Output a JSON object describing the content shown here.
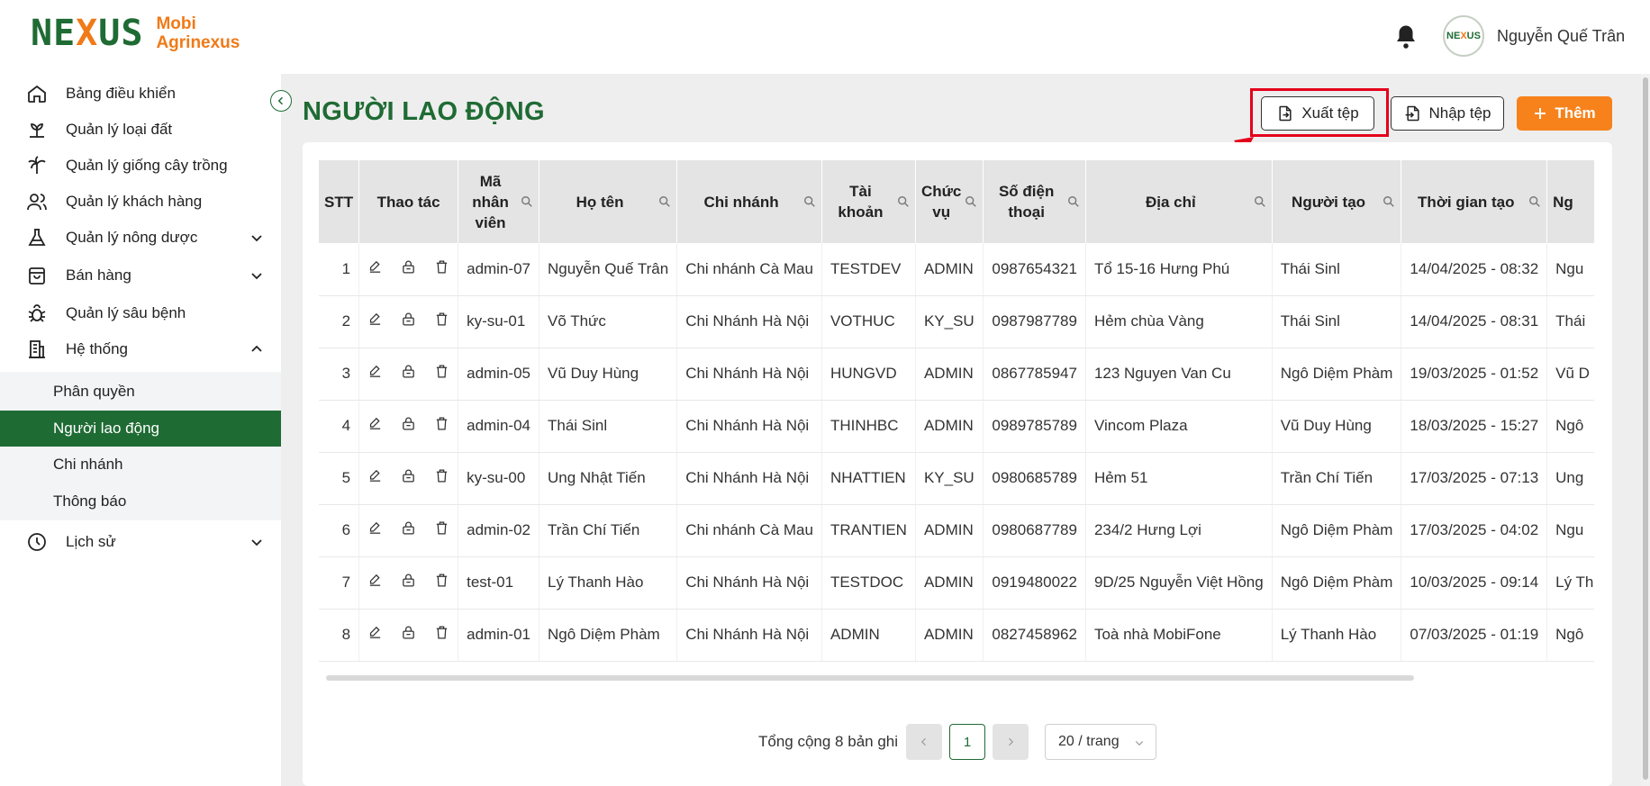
{
  "app": {
    "brand_mark_left": "NE",
    "brand_mark_x": "X",
    "brand_mark_right": "US",
    "brand_line1": "Mobi",
    "brand_line2": "Agrinexus",
    "avatar_text_left": "NE",
    "avatar_text_x": "X",
    "avatar_text_right": "US",
    "user_name": "Nguyễn Quế Trân"
  },
  "sidebar": {
    "items": [
      {
        "label": "Bảng điều khiển",
        "icon": "home-icon"
      },
      {
        "label": "Quản lý loại đất",
        "icon": "sprout-icon"
      },
      {
        "label": "Quản lý giống cây trồng",
        "icon": "palm-icon"
      },
      {
        "label": "Quản lý khách hàng",
        "icon": "users-icon"
      },
      {
        "label": "Quản lý nông dược",
        "icon": "flask-icon"
      },
      {
        "label": "Bán hàng",
        "icon": "bag-icon"
      },
      {
        "label": "Quản lý sâu bệnh",
        "icon": "bug-icon"
      },
      {
        "label": "Hệ thống",
        "icon": "building-icon"
      },
      {
        "label": "Lịch sử",
        "icon": "clock-icon"
      }
    ],
    "submenu": [
      {
        "label": "Phân quyền"
      },
      {
        "label": "Người lao động",
        "active": true
      },
      {
        "label": "Chi nhánh"
      },
      {
        "label": "Thông báo"
      }
    ]
  },
  "page": {
    "title": "NGƯỜI LAO ĐỘNG",
    "export_label": "Xuất tệp",
    "import_label": "Nhập tệp",
    "add_label": "Thêm"
  },
  "table": {
    "headers": [
      "STT",
      "Thao tác",
      "Mã nhân viên",
      "Họ tên",
      "Chi nhánh",
      "Tài khoản",
      "Chức vụ",
      "Số điện thoại",
      "Địa chỉ",
      "Người tạo",
      "Thời gian tạo",
      "Ng"
    ],
    "rows": [
      [
        "1",
        "admin-07",
        "Nguyễn Quế Trân",
        "Chi nhánh Cà Mau",
        "TESTDEV",
        "ADMIN",
        "0987654321",
        "Tổ 15-16 Hưng Phú",
        "Thái Sinl",
        "14/04/2025 - 08:32",
        "Ngu"
      ],
      [
        "2",
        "ky-su-01",
        "Võ Thức",
        "Chi Nhánh Hà Nội",
        "VOTHUC",
        "KY_SU",
        "0987987789",
        "Hẻm chùa Vàng",
        "Thái Sinl",
        "14/04/2025 - 08:31",
        "Thái"
      ],
      [
        "3",
        "admin-05",
        "Vũ Duy Hùng",
        "Chi Nhánh Hà Nội",
        "HUNGVD",
        "ADMIN",
        "0867785947",
        "123 Nguyen Van Cu",
        "Ngô Diệm Phàm",
        "19/03/2025 - 01:52",
        "Vũ D"
      ],
      [
        "4",
        "admin-04",
        "Thái Sinl",
        "Chi Nhánh Hà Nội",
        "THINHBC",
        "ADMIN",
        "0989785789",
        "Vincom Plaza",
        "Vũ Duy Hùng",
        "18/03/2025 - 15:27",
        "Ngô"
      ],
      [
        "5",
        "ky-su-00",
        "Ung Nhật Tiến",
        "Chi Nhánh Hà Nội",
        "NHATTIEN",
        "KY_SU",
        "0980685789",
        "Hẻm 51",
        "Trần Chí Tiến",
        "17/03/2025 - 07:13",
        "Ung"
      ],
      [
        "6",
        "admin-02",
        "Trần Chí Tiến",
        "Chi nhánh Cà Mau",
        "TRANTIEN",
        "ADMIN",
        "0980687789",
        "234/2 Hưng Lợi",
        "Ngô Diệm Phàm",
        "17/03/2025 - 04:02",
        "Ngu"
      ],
      [
        "7",
        "test-01",
        "Lý Thanh Hào",
        "Chi Nhánh Hà Nội",
        "TESTDOC",
        "ADMIN",
        "0919480022",
        "9D/25 Nguyễn Việt Hồng",
        "Ngô Diệm Phàm",
        "10/03/2025 - 09:14",
        "Lý Th"
      ],
      [
        "8",
        "admin-01",
        "Ngô Diệm Phàm",
        "Chi Nhánh Hà Nội",
        "ADMIN",
        "ADMIN",
        "0827458962",
        "Toà nhà MobiFone",
        "Lý Thanh Hào",
        "07/03/2025 - 01:19",
        "Ngô"
      ]
    ]
  },
  "pagination": {
    "total_text": "Tổng cộng 8 bản ghi",
    "prev": "<",
    "current_page": "1",
    "next": ">",
    "page_size": "20 / trang"
  },
  "colors": {
    "primary_green": "#1f6b34",
    "accent_orange": "#f7821b",
    "highlight_red": "#e4001b"
  }
}
